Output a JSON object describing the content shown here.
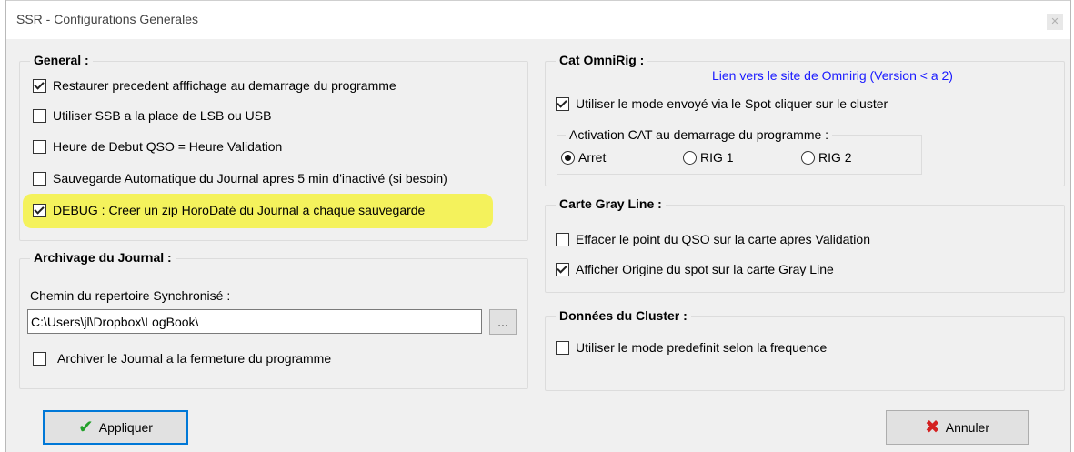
{
  "window": {
    "title": "SSR - Configurations Generales",
    "close_icon": "close-icon"
  },
  "general": {
    "title": "General :",
    "options": [
      {
        "label": "Restaurer precedent afffichage au demarrage du programme",
        "checked": true
      },
      {
        "label": "Utiliser SSB a la place de LSB ou USB",
        "checked": false
      },
      {
        "label": "Heure de Debut QSO = Heure Validation",
        "checked": false
      },
      {
        "label": "Sauvegarde Automatique du Journal apres 5 min d'inactivé  (si besoin)",
        "checked": false
      },
      {
        "label": "DEBUG : Creer un zip HoroDaté du Journal a chaque sauvegarde",
        "checked": true
      }
    ],
    "highlight_color": "#f4f25c"
  },
  "archivage": {
    "title": "Archivage du Journal :",
    "path_label": "Chemin du repertoire Synchronisé :",
    "path_value": "C:\\Users\\jl\\Dropbox\\LogBook\\",
    "browse_label": "...",
    "archive_on_close": {
      "label": "Archiver le Journal a la fermeture du programme",
      "checked": false
    }
  },
  "cat": {
    "title": "Cat  OmniRig :",
    "link": "Lien vers le site de Omnirig  (Version < a 2)",
    "use_spot_mode": {
      "label": "Utiliser le mode envoyé via le Spot cliquer sur le cluster",
      "checked": true
    },
    "activation": {
      "title": "Activation CAT  au demarrage du programme :",
      "options": [
        {
          "label": "Arret",
          "checked": true
        },
        {
          "label": "RIG 1",
          "checked": false
        },
        {
          "label": "RIG 2",
          "checked": false
        }
      ]
    }
  },
  "grayline": {
    "title": "Carte Gray Line :",
    "options": [
      {
        "label": "Effacer le point du QSO sur la carte apres Validation",
        "checked": false
      },
      {
        "label": "Afficher Origine du spot sur la carte Gray Line",
        "checked": true
      }
    ]
  },
  "cluster": {
    "title": "Données du Cluster :",
    "options": [
      {
        "label": "Utiliser le mode predefinit selon la frequence",
        "checked": false
      }
    ]
  },
  "buttons": {
    "apply": {
      "label": "Appliquer",
      "icon": "checkmark-icon",
      "color": "#22a02a"
    },
    "cancel": {
      "label": "Annuler",
      "icon": "x-icon",
      "color": "#d42020"
    }
  }
}
